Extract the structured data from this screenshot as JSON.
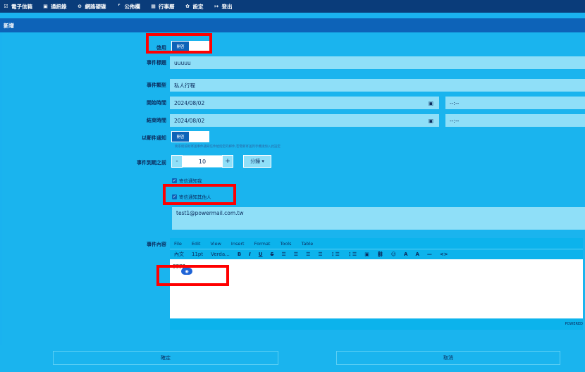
{
  "nav": {
    "items": [
      {
        "icon": "☑",
        "label": "電子信箱"
      },
      {
        "icon": "▣",
        "label": "通訊錄"
      },
      {
        "icon": "⊖",
        "label": "網路硬碟"
      },
      {
        "icon": "⌜",
        "label": "公佈欄"
      },
      {
        "icon": "▦",
        "label": "行事曆"
      },
      {
        "icon": "✿",
        "label": "設定"
      },
      {
        "icon": "↦",
        "label": "登出"
      }
    ]
  },
  "subheader": {
    "title": "新增"
  },
  "form": {
    "enable": {
      "label": "啓用",
      "toggle_text": "開啓"
    },
    "title": {
      "label": "事件標題",
      "value": "uuuuu"
    },
    "type": {
      "label": "事件類型",
      "value": "私人行程"
    },
    "start": {
      "label": "開始時間",
      "date": "2024/08/02",
      "time": "--:--"
    },
    "end": {
      "label": "結束時間",
      "date": "2024/08/02",
      "time": "--:--"
    },
    "email_notify": {
      "label": "以郵件通知",
      "toggle_text": "開啓",
      "hint": "要系統協助寄送事件通知信件給指定的郵件,若需要寄送到手機請加入此設定"
    },
    "before": {
      "label": "事件到期之前",
      "minus": "-",
      "value": "10",
      "plus": "+",
      "unit": "分鐘 ▾"
    },
    "notify_me": {
      "label": "寄信通知我",
      "checked": true
    },
    "notify_others": {
      "label": "寄信通知其他人",
      "checked": true
    },
    "recipients": {
      "value": "test1@powermail.com.tw"
    },
    "content": {
      "label": "事件內容"
    }
  },
  "editor": {
    "menu": [
      "File",
      "Edit",
      "View",
      "Insert",
      "Format",
      "Tools",
      "Table"
    ],
    "toolbar": [
      "內文",
      "11pt",
      "Verda...",
      "B",
      "I",
      "U",
      "S",
      "☰",
      "☰",
      "☰",
      "☰",
      "⋮☰",
      "⋮☰",
      "▣",
      "⛓",
      "☺",
      "A",
      "A",
      "—",
      "<>"
    ],
    "content": "gggg",
    "status": "POWERED"
  },
  "buttons": {
    "confirm": "確定",
    "cancel": "取消"
  },
  "colors": {
    "topbar": "#0a3c7a",
    "subbar": "#0d63b8",
    "background": "#1ab4ee",
    "field": "#8fdff8",
    "highlight": "#ff0000"
  }
}
